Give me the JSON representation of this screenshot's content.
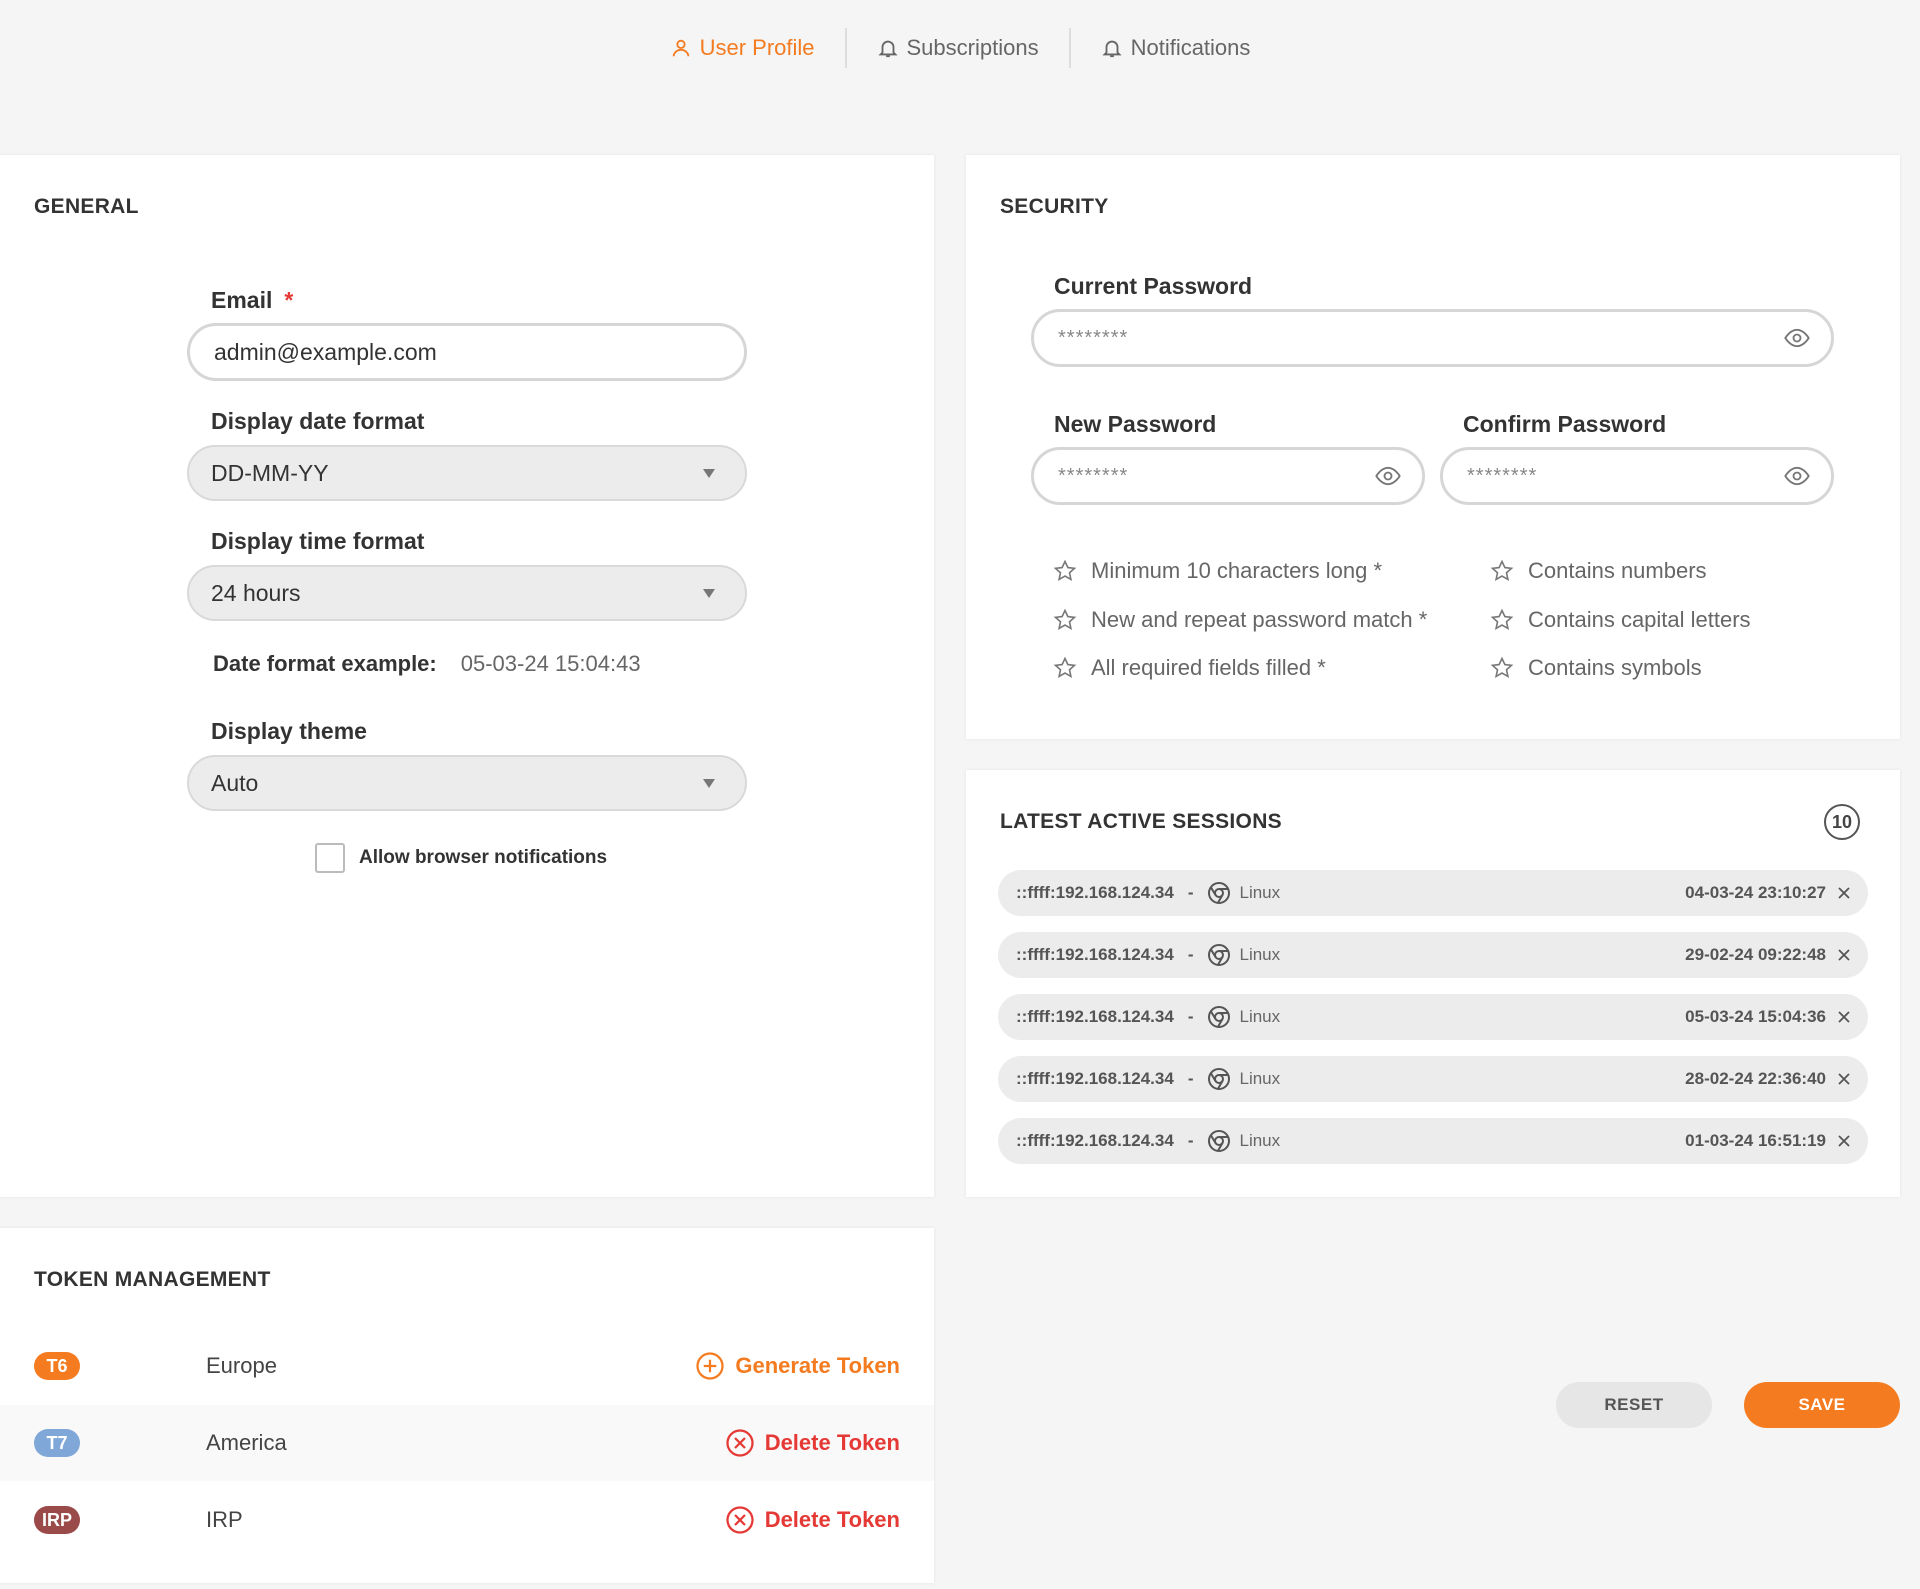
{
  "tabs": [
    {
      "label": "User Profile",
      "active": true,
      "icon": "user-icon"
    },
    {
      "label": "Subscriptions",
      "active": false,
      "icon": "bell-icon"
    },
    {
      "label": "Notifications",
      "active": false,
      "icon": "bell-icon"
    }
  ],
  "colors": {
    "accent": "#f47b20",
    "danger": "#e53935"
  },
  "general": {
    "title": "GENERAL",
    "email_label": "Email",
    "email_required": "*",
    "email_value": "admin@example.com",
    "date_format_label": "Display date format",
    "date_format_value": "DD-MM-YY",
    "time_format_label": "Display time format",
    "time_format_value": "24 hours",
    "example_label": "Date format example:",
    "example_value": "05-03-24 15:04:43",
    "theme_label": "Display theme",
    "theme_value": "Auto",
    "notifications_label": "Allow browser notifications"
  },
  "security": {
    "title": "SECURITY",
    "current_label": "Current Password",
    "current_value": "********",
    "new_label": "New Password",
    "new_value": "********",
    "confirm_label": "Confirm Password",
    "confirm_value": "********",
    "rules": [
      "Minimum 10 characters long *",
      "New and repeat password match *",
      "All required fields filled *",
      "Contains numbers",
      "Contains capital letters",
      "Contains symbols"
    ]
  },
  "sessions": {
    "title": "LATEST ACTIVE SESSIONS",
    "count": "10",
    "items": [
      {
        "ip": "::ffff:192.168.124.34",
        "dash": "-",
        "os": "Linux",
        "time": "04-03-24 23:10:27"
      },
      {
        "ip": "::ffff:192.168.124.34",
        "dash": "-",
        "os": "Linux",
        "time": "29-02-24 09:22:48"
      },
      {
        "ip": "::ffff:192.168.124.34",
        "dash": "-",
        "os": "Linux",
        "time": "05-03-24 15:04:36"
      },
      {
        "ip": "::ffff:192.168.124.34",
        "dash": "-",
        "os": "Linux",
        "time": "28-02-24 22:36:40"
      },
      {
        "ip": "::ffff:192.168.124.34",
        "dash": "-",
        "os": "Linux",
        "time": "01-03-24 16:51:19"
      }
    ]
  },
  "tokens": {
    "title": "TOKEN MANAGEMENT",
    "items": [
      {
        "badge": "T6",
        "badge_color": "#f47b20",
        "region": "Europe",
        "action": "Generate Token",
        "action_color": "#f47b20"
      },
      {
        "badge": "T7",
        "badge_color": "#7fa7d8",
        "region": "America",
        "action": "Delete Token",
        "action_color": "#e53935"
      },
      {
        "badge": "IRP",
        "badge_color": "#9b4a4a",
        "region": "IRP",
        "action": "Delete Token",
        "action_color": "#e53935"
      }
    ]
  },
  "buttons": {
    "reset": "RESET",
    "save": "SAVE"
  }
}
